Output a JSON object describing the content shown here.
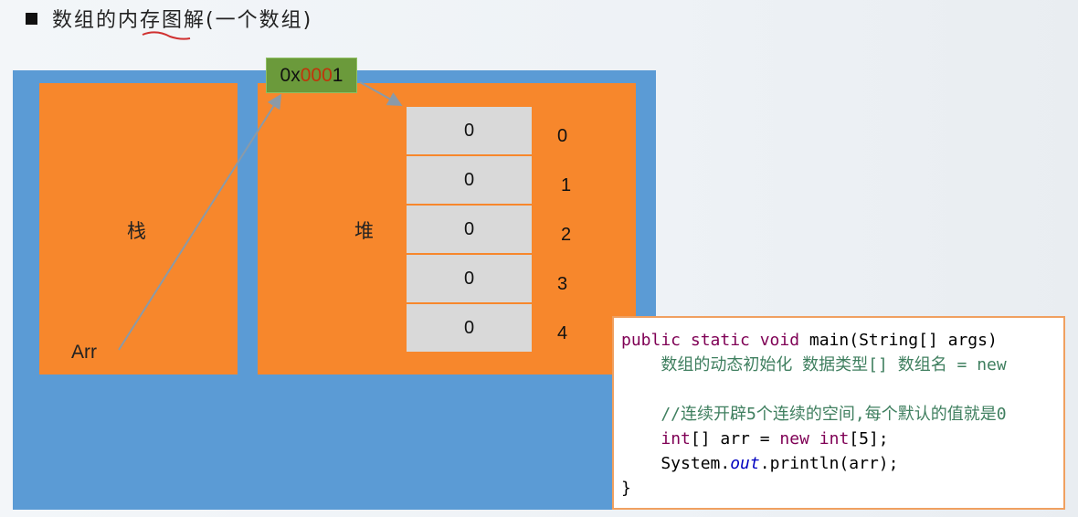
{
  "title": "数组的内存图解(一个数组)",
  "stack": {
    "label": "栈",
    "var": "Arr"
  },
  "heap": {
    "label": "堆"
  },
  "address": {
    "prefix": "0x",
    "mid": "000",
    "suffix": "1"
  },
  "cells": [
    "0",
    "0",
    "0",
    "0",
    "0"
  ],
  "indices": [
    "0",
    "1",
    "2",
    "3",
    "4"
  ],
  "code": {
    "l1_kw": "public static void ",
    "l1_rest": "main(String[] args)",
    "l2": "    数组的动态初始化 数据类型[] 数组名 = new",
    "l4": "    //连续开辟5个连续的空间,每个默认的值就是0",
    "l5_kw1": "int",
    "l5_a": "[] arr = ",
    "l5_kw2": "new int",
    "l5_b": "[5];",
    "l6_a": "    System.",
    "l6_f": "out",
    "l6_b": ".println(arr);",
    "l7": "}"
  },
  "colors": {
    "blue": "#5b9bd5",
    "orange": "#f7872c",
    "green": "#6b9a3b",
    "cell": "#d9d9d9"
  }
}
